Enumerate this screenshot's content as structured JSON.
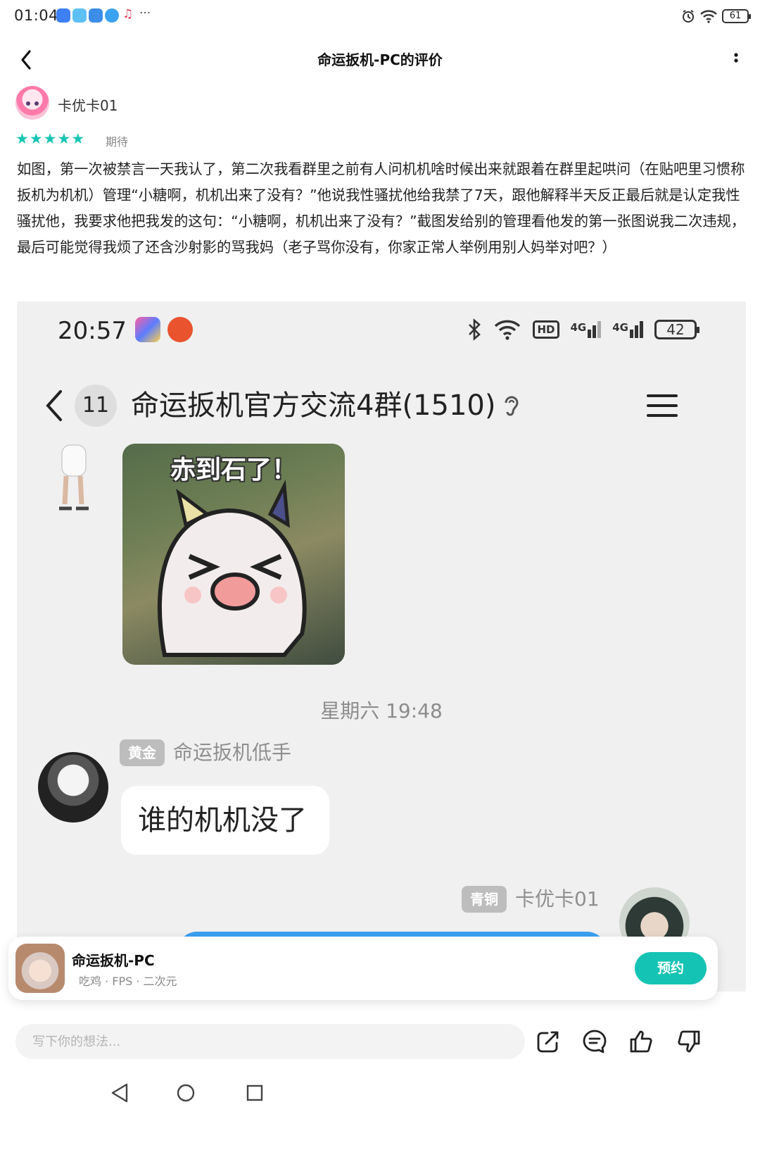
{
  "status_bar": {
    "time": "01:04",
    "more": "···",
    "battery": "61"
  },
  "header": {
    "title": "命运扳机-PC的评价"
  },
  "review": {
    "author": "卡优卡01",
    "stars": 5,
    "rating_label": "期待",
    "text": "如图，第一次被禁言一天我认了，第二次我看群里之前有人问机机啥时候出来就跟着在群里起哄问（在贴吧里习惯称扳机为机机）管理“小糖啊，机机出来了没有？”他说我性骚扰他给我禁了7天，跟他解释半天反正最后就是认定我性骚扰他，我要求他把我发的这句：“小糖啊，机机出来了没有？”截图发给别的管理看他发的第一张图说我二次违规，最后可能觉得我烦了还含沙射影的骂我妈（老子骂你没有，你家正常人举例用别人妈举对吧？）"
  },
  "screenshot": {
    "time": "20:57",
    "hd_label": "HD",
    "net1": "4G",
    "net2": "4G",
    "battery": "42",
    "unread_count": "11",
    "group_title": "命运扳机官方交流4群(1510)",
    "sticker_caption": "赤到石了！",
    "date_divider": "星期六 19:48",
    "msg1": {
      "badge": "黄金",
      "sender": "命运扳机低手",
      "text": "谁的机机没了"
    },
    "msg2": {
      "badge": "青铜",
      "sender": "卡优卡01"
    }
  },
  "game_card": {
    "name": "命运扳机-PC",
    "tags": "吃鸡 · FPS · 二次元",
    "button": "预约"
  },
  "comment_bar": {
    "placeholder": "写下你的想法..."
  },
  "colors": {
    "accent": "#15c3b4",
    "star": "#16c5b5",
    "bubble_blue": "#3aa0f0"
  },
  "icons": [
    "back-icon",
    "more-vertical-icon",
    "share-icon",
    "comment-icon",
    "thumbs-up-icon",
    "thumbs-down-icon",
    "nav-back-icon",
    "nav-home-icon",
    "nav-recents-icon"
  ]
}
